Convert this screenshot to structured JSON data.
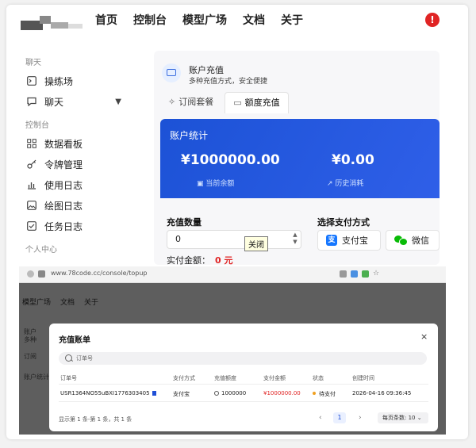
{
  "header": {
    "nav": [
      "首页",
      "控制台",
      "模型广场",
      "文档",
      "关于"
    ],
    "alert_glyph": "!"
  },
  "sidebar": {
    "group_chat": "聊天",
    "group_console": "控制台",
    "group_personal": "个人中心",
    "items": {
      "playground": "操练场",
      "chat": "聊天",
      "dashboard": "数据看板",
      "tokens": "令牌管理",
      "usage_log": "使用日志",
      "drawing_log": "绘图日志",
      "task_log": "任务日志"
    }
  },
  "account": {
    "title": "账户充值",
    "subtitle": "多种充值方式，安全便捷",
    "tabs": [
      "订阅套餐",
      "额度充值"
    ],
    "stats_title": "账户统计",
    "balance": "¥1000000.00",
    "balance_label": "当前余额",
    "history": "¥0.00",
    "history_label": "历史消耗",
    "quantity_label": "充值数量",
    "quantity_value": "0",
    "pay_method_label": "选择支付方式",
    "pay_alipay": "支付宝",
    "pay_wechat": "微信",
    "amount_label": "实付金额：",
    "amount_value": "0 元",
    "tooltip_close": "关闭"
  },
  "browser": {
    "url": "www.78code.cc/console/topup"
  },
  "background": {
    "nav": [
      "模型广场",
      "文档",
      "关于"
    ],
    "side1": "账户",
    "side1b": "多种",
    "side2": "订阅",
    "side3": "账户统计"
  },
  "modal": {
    "title": "充值账单",
    "close": "×",
    "search_placeholder": "订单号",
    "columns": [
      "订单号",
      "支付方式",
      "充值额度",
      "支付金额",
      "状态",
      "创建时间"
    ],
    "rows": [
      {
        "order_id": "USR1364NO55uBXI1776303405",
        "method": "支付宝",
        "quota": "1000000",
        "amount": "¥1000000.00",
        "status": "待支付",
        "created": "2026-04-16 09:36:45"
      }
    ],
    "page_info": "显示第 1 条-第 1 条，共 1 条",
    "page_current": "1",
    "page_size": "每页条数: 10"
  },
  "colors": {
    "accent": "#1f4fd6",
    "danger": "#e02424",
    "status_pending": "#f0a020"
  }
}
